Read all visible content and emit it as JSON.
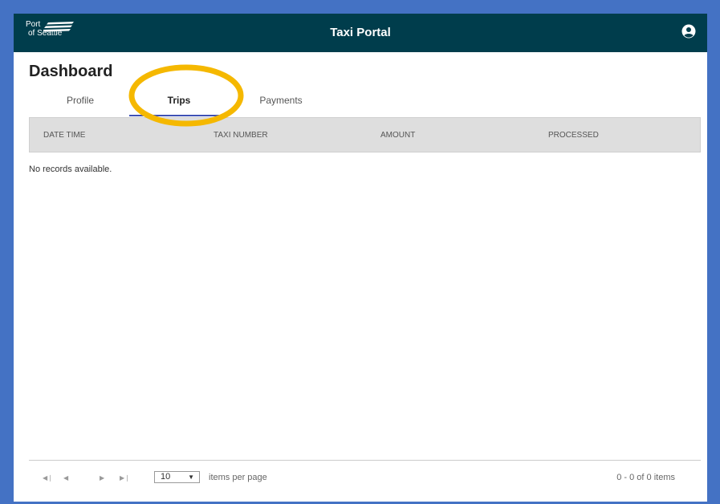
{
  "header": {
    "logo_line1": "Port",
    "logo_line2": "of Seattle",
    "title": "Taxi Portal",
    "user_icon": "user-circle-icon"
  },
  "page": {
    "title": "Dashboard"
  },
  "tabs": [
    {
      "label": "Profile",
      "active": false
    },
    {
      "label": "Trips",
      "active": true
    },
    {
      "label": "Payments",
      "active": false
    }
  ],
  "grid": {
    "columns": [
      "DATE TIME",
      "TAXI NUMBER",
      "AMOUNT",
      "PROCESSED"
    ],
    "empty_message": "No records available."
  },
  "pager": {
    "first_icon": "first-page-icon",
    "prev_icon": "prev-page-icon",
    "next_icon": "next-page-icon",
    "last_icon": "last-page-icon",
    "page_size": "10",
    "items_per_page_label": "items per page",
    "info": "0 - 0 of 0 items"
  },
  "annotation": {
    "color": "#f5b800"
  }
}
